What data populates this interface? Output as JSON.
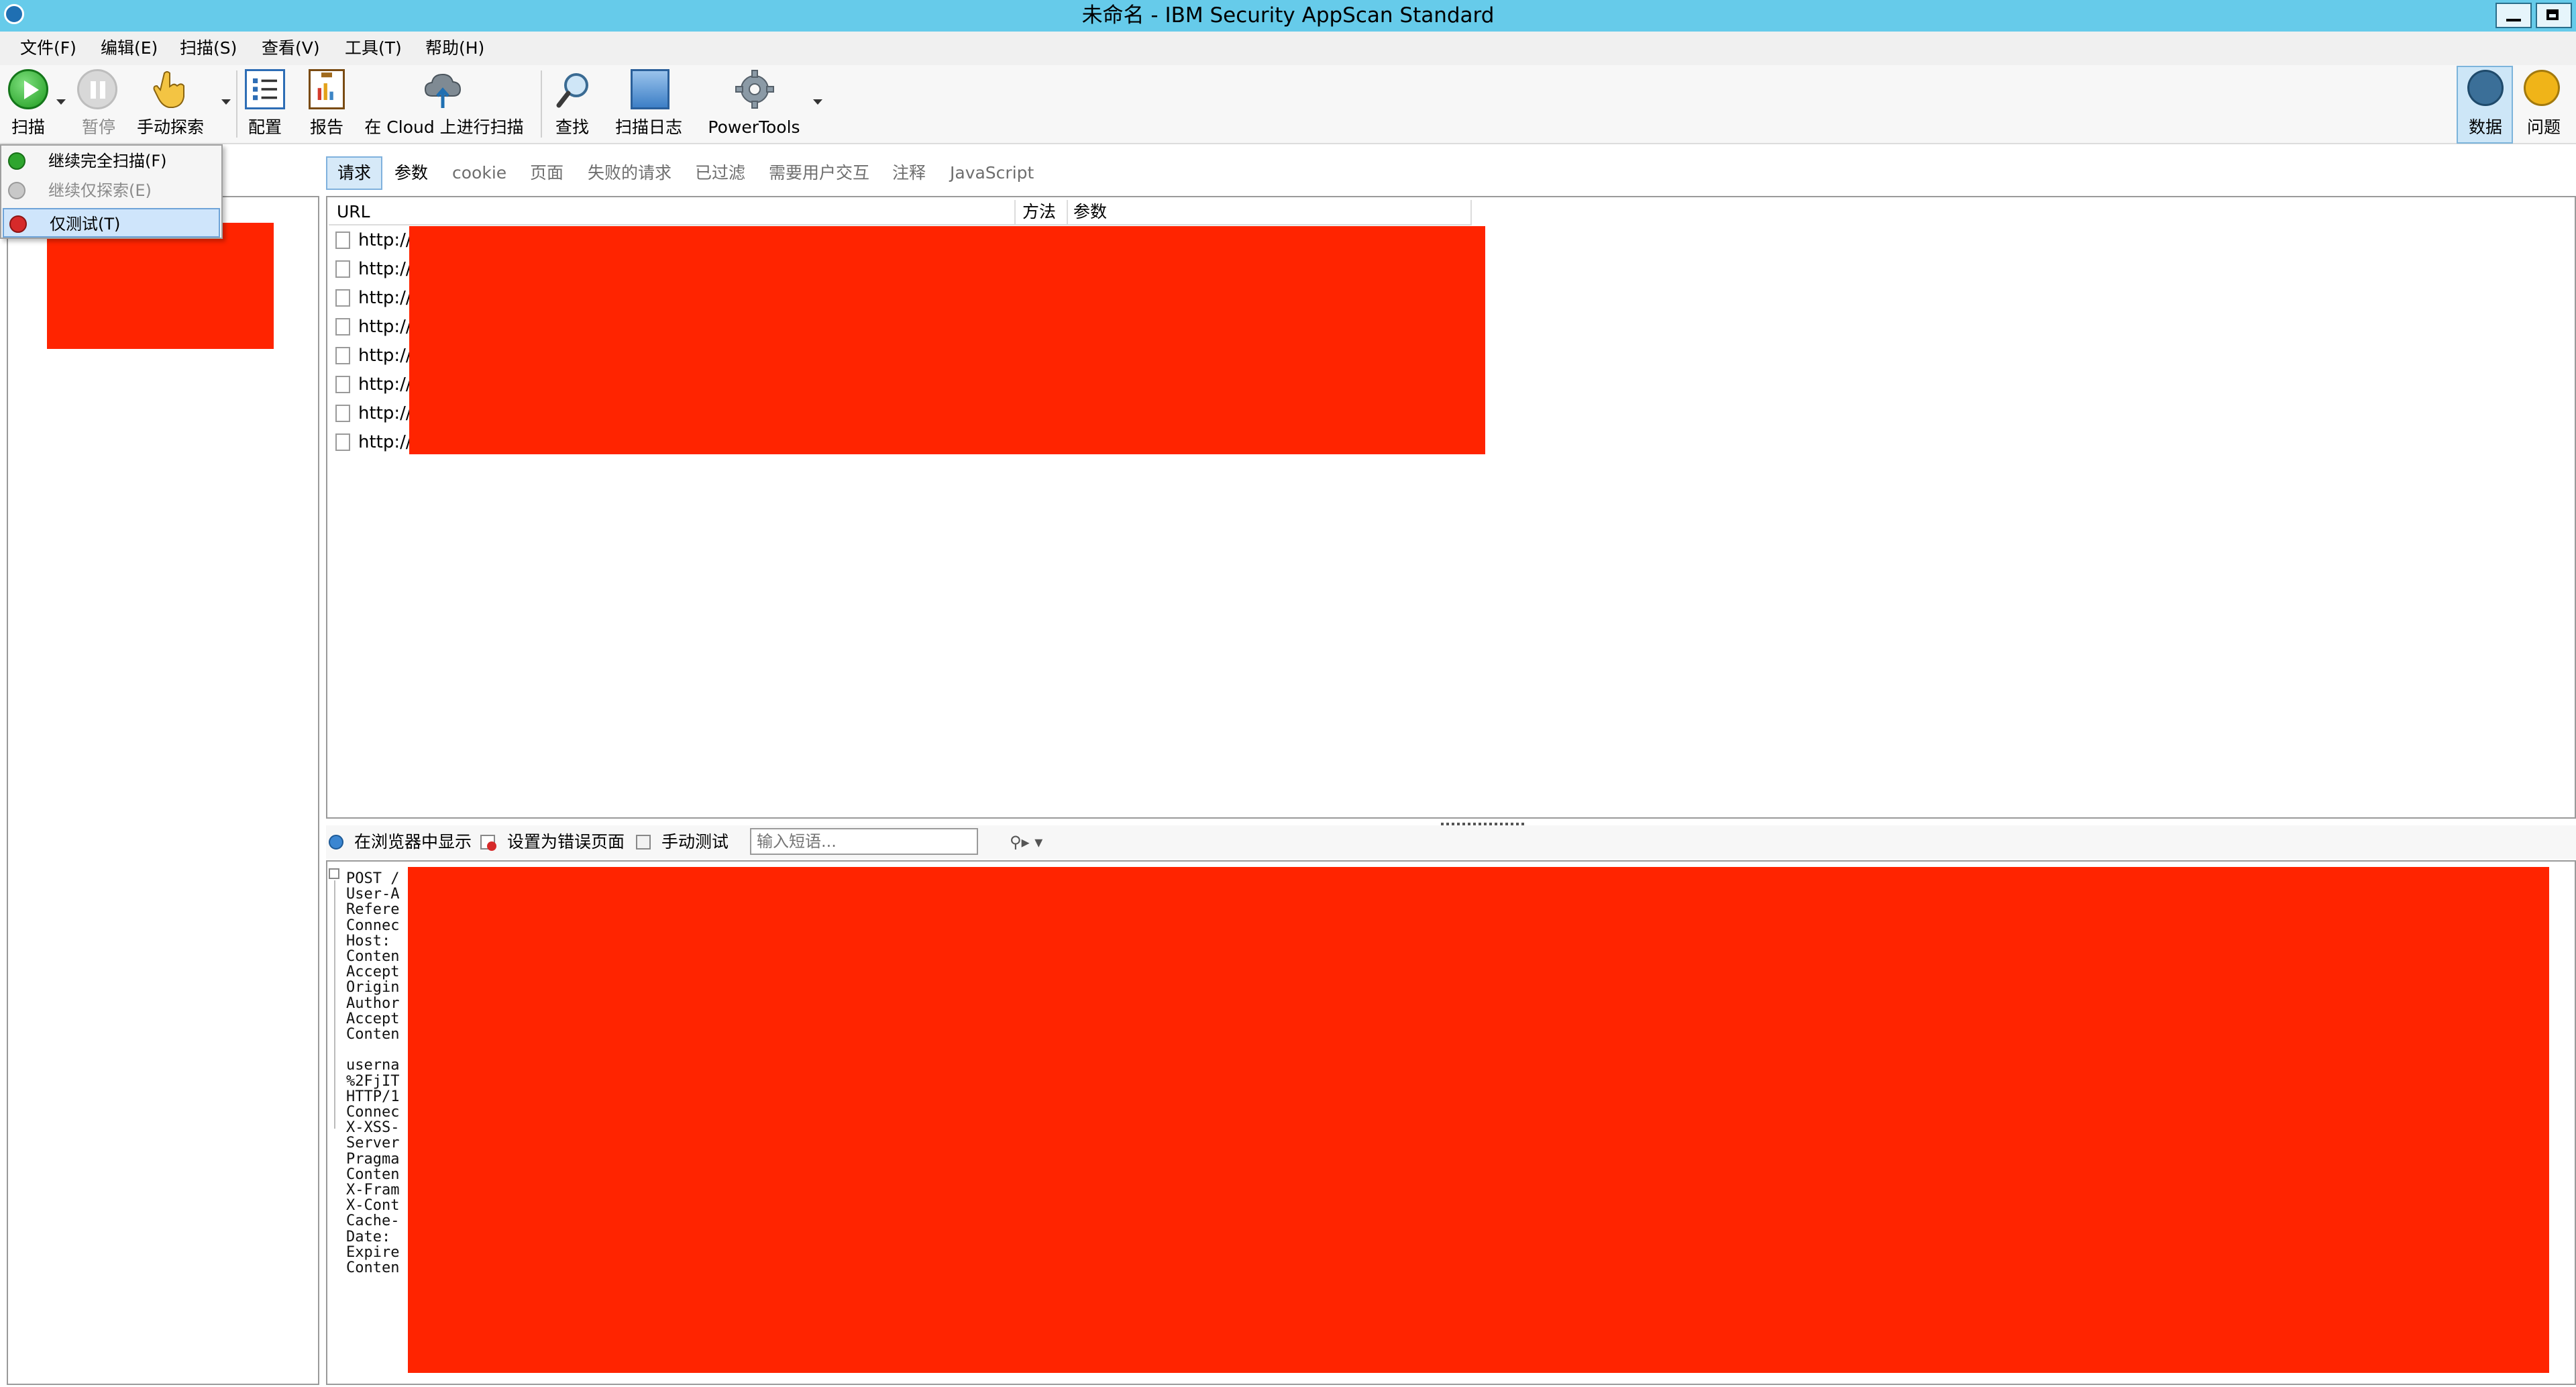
{
  "window": {
    "title": "未命名 - IBM Security AppScan Standard"
  },
  "menu": [
    "文件(F)",
    "编辑(E)",
    "扫描(S)",
    "查看(V)",
    "工具(T)",
    "帮助(H)"
  ],
  "toolbar": {
    "scan": "扫描",
    "pause": "暂停",
    "manual_explore": "手动探索",
    "config": "配置",
    "report": "报告",
    "cloud_scan": "在 Cloud 上进行扫描",
    "find": "查找",
    "scan_log": "扫描日志",
    "powertools": "PowerTools",
    "data": "数据",
    "issues": "问题"
  },
  "scan_dropdown": {
    "items": [
      {
        "label": "继续完全扫描(F)",
        "enabled": true
      },
      {
        "label": "继续仅探索(E)",
        "enabled": false
      },
      {
        "label": "仅测试(T)",
        "enabled": true,
        "highlighted": true
      }
    ]
  },
  "tabs": [
    "请求",
    "参数",
    "cookie",
    "页面",
    "失败的请求",
    "已过滤",
    "需要用户交互",
    "注释",
    "JavaScript"
  ],
  "active_tab": "请求",
  "request_table": {
    "columns": [
      "URL",
      "方法",
      "参数"
    ],
    "rows": [
      "http://",
      "http://",
      "http://",
      "http://",
      "http://",
      "http://",
      "http://",
      "http://"
    ]
  },
  "lower_toolbar": {
    "show_in_browser": "在浏览器中显示",
    "set_error_page": "设置为错误页面",
    "manual_test": "手动测试",
    "phrase_placeholder": "输入短语..."
  },
  "request_detail": {
    "lines": [
      "POST /",
      "User-A",
      "Refere",
      "Connec",
      "Host: ",
      "Conten",
      "Accept",
      "Origin",
      "Author",
      "Accept",
      "Conten",
      "",
      "userna",
      "%2FjIT",
      "HTTP/1",
      "Connec",
      "X-XSS-",
      "Server",
      "Pragma",
      "Conten",
      "X-Fram",
      "X-Cont",
      "Cache-",
      "Date: ",
      "Expire",
      "Conten"
    ]
  },
  "colors": {
    "titlebar": "#66cbea",
    "redaction": "#ff2400",
    "selection": "#cfe5fb"
  }
}
